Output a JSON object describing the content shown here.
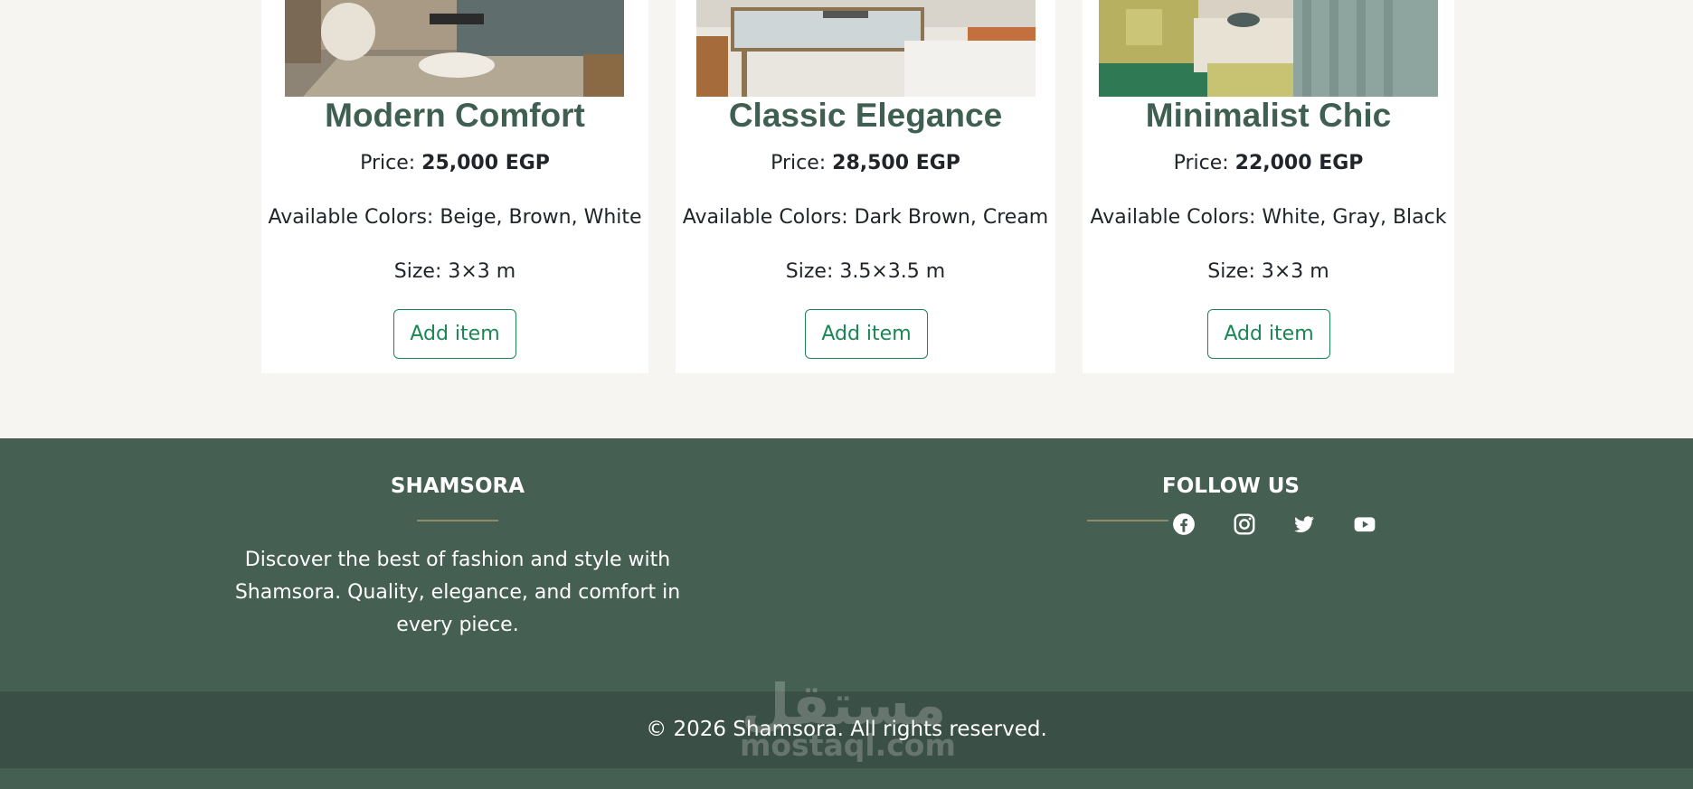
{
  "products": [
    {
      "title": "Modern Comfort",
      "price_label": "Price: ",
      "price": "25,000 EGP",
      "colors": "Available Colors: Beige, Brown, White",
      "size": "Size: 3×3 m",
      "button": "Add item"
    },
    {
      "title": "Classic Elegance",
      "price_label": "Price: ",
      "price": "28,500 EGP",
      "colors": "Available Colors: Dark Brown, Cream",
      "size": "Size: 3.5×3.5 m",
      "button": "Add item"
    },
    {
      "title": "Minimalist Chic",
      "price_label": "Price: ",
      "price": "22,000 EGP",
      "colors": "Available Colors: White, Gray, Black",
      "size": "Size: 3×3 m",
      "button": "Add item"
    }
  ],
  "footer": {
    "brand": "SHAMSORA",
    "description": "Discover the best of fashion and style with Shamsora. Quality, elegance, and comfort in every piece.",
    "follow_title": "FOLLOW US",
    "social": [
      {
        "icon": "facebook-icon"
      },
      {
        "icon": "instagram-icon"
      },
      {
        "icon": "twitter-icon"
      },
      {
        "icon": "youtube-icon"
      }
    ],
    "copyright": "© 2026 Shamsora. All rights reserved."
  },
  "watermark": {
    "arabic": "مستقل",
    "latin": "mostaql.com"
  },
  "colors": {
    "page_bg": "#f6f5f1",
    "heading": "#3f5f52",
    "button_accent": "#198754",
    "footer_bg": "#455f53",
    "footer_bottom_bg": "#3a4f45",
    "divider": "#8f8a6a"
  }
}
